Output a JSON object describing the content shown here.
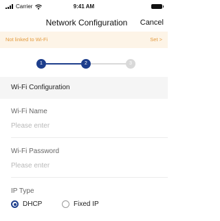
{
  "status_bar": {
    "carrier": "Carrier",
    "time": "9:41 AM"
  },
  "nav": {
    "title": "Network Configuration",
    "cancel_label": "Cancel"
  },
  "banner": {
    "text": "Not linked to Wi-Fi",
    "action": "Set >"
  },
  "stepper": {
    "steps": [
      {
        "number": "1",
        "state": "completed"
      },
      {
        "number": "2",
        "state": "current"
      },
      {
        "number": "3",
        "state": "pending"
      }
    ]
  },
  "section": {
    "title": "Wi-Fi Configuration"
  },
  "form": {
    "wifi_name": {
      "label": "Wi-Fi Name",
      "placeholder": "Please enter",
      "value": ""
    },
    "wifi_password": {
      "label": "Wi-Fi Password",
      "placeholder": "Please enter",
      "value": ""
    },
    "ip_type": {
      "label": "IP Type",
      "options": [
        {
          "label": "DHCP",
          "selected": true
        },
        {
          "label": "Fixed IP",
          "selected": false
        }
      ]
    }
  },
  "colors": {
    "accent": "#1d3e8c",
    "banner_text": "#e39a3d",
    "banner_bg": "#fdf4e7",
    "inactive": "#d9d9d9"
  }
}
